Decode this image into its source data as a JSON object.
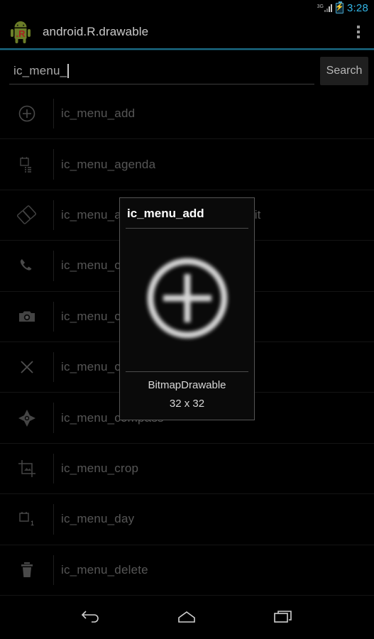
{
  "status_bar": {
    "network_label": "3G",
    "signal_icon": "signal-bars-icon",
    "battery_icon": "battery-charging-icon",
    "time": "3:28",
    "time_color": "#33b5e5"
  },
  "action_bar": {
    "app_icon": "android-robot-r-icon",
    "title": "android.R.drawable",
    "overflow_icon": "overflow-menu-icon",
    "divider_color": "#1a6b85"
  },
  "search": {
    "value": "ic_menu_",
    "placeholder": "",
    "button_label": "Search"
  },
  "list": {
    "items": [
      {
        "icon": "plus-circle-icon",
        "label": "ic_menu_add"
      },
      {
        "icon": "agenda-icon",
        "label": "ic_menu_agenda"
      },
      {
        "icon": "rotate-icon",
        "label": "ic_menu_always_landscape_portrait"
      },
      {
        "icon": "phone-icon",
        "label": "ic_menu_call"
      },
      {
        "icon": "camera-icon",
        "label": "ic_menu_camera"
      },
      {
        "icon": "close-x-icon",
        "label": "ic_menu_close_clear_cancel"
      },
      {
        "icon": "compass-icon",
        "label": "ic_menu_compass"
      },
      {
        "icon": "crop-icon",
        "label": "ic_menu_crop"
      },
      {
        "icon": "day-calendar-icon",
        "label": "ic_menu_day"
      },
      {
        "icon": "trash-icon",
        "label": "ic_menu_delete"
      }
    ]
  },
  "dialog": {
    "title": "ic_menu_add",
    "preview_icon": "plus-circle-large-icon",
    "drawable_type": "BitmapDrawable",
    "dimensions": "32 x 32"
  },
  "nav_bar": {
    "back": "back-arrow-icon",
    "home": "home-icon",
    "recents": "recents-icon"
  }
}
